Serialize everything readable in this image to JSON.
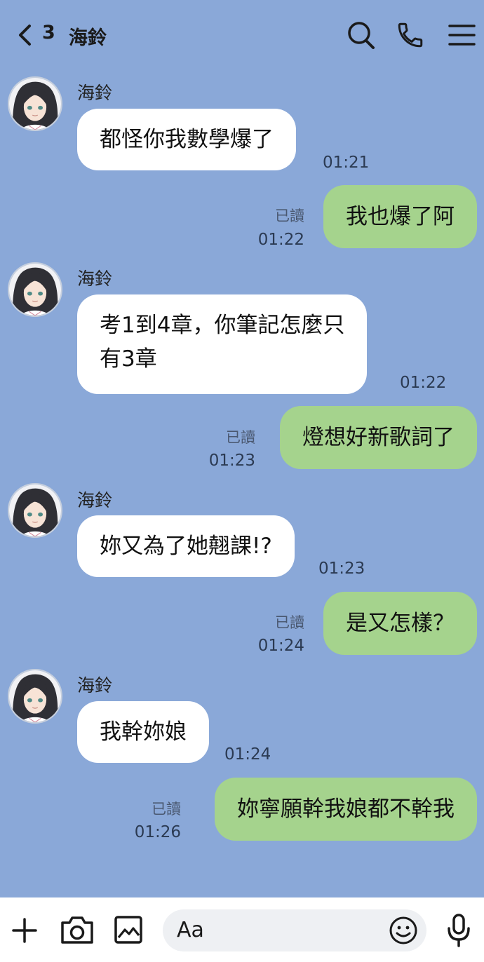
{
  "header": {
    "unread_count": "3",
    "chat_title": "海鈴"
  },
  "messages": [
    {
      "dir": "in",
      "sender": "海鈴",
      "text": "都怪你我數學爆了",
      "time": "01:21"
    },
    {
      "dir": "out",
      "read": "已讀",
      "text": "我也爆了阿",
      "time": "01:22"
    },
    {
      "dir": "in",
      "sender": "海鈴",
      "lines": [
        "考1到4章，你筆記怎麼只",
        "有3章"
      ],
      "time": "01:22"
    },
    {
      "dir": "out",
      "read": "已讀",
      "text": "燈想好新歌詞了",
      "time": "01:23"
    },
    {
      "dir": "in",
      "sender": "海鈴",
      "text": "妳又為了她翹課!?",
      "time": "01:23"
    },
    {
      "dir": "out",
      "read": "已讀",
      "text": "是又怎樣？",
      "time": "01:24"
    },
    {
      "dir": "in",
      "sender": "海鈴",
      "text": "我幹妳娘",
      "time": "01:24"
    },
    {
      "dir": "out",
      "read": "已讀",
      "text": "妳寧願幹我娘都不幹我",
      "time": "01:26"
    }
  ],
  "footer": {
    "input_placeholder": "Aa"
  },
  "icons": {
    "back": "chevron-left-icon",
    "search": "search-icon",
    "call": "phone-icon",
    "menu": "hamburger-menu-icon",
    "add": "plus-icon",
    "camera": "camera-icon",
    "gallery": "image-icon",
    "sticker": "smiley-icon",
    "voice": "microphone-icon"
  },
  "colors": {
    "background": "#8aa8d8",
    "incoming_bubble": "#ffffff",
    "outgoing_bubble": "#a5d38d"
  }
}
